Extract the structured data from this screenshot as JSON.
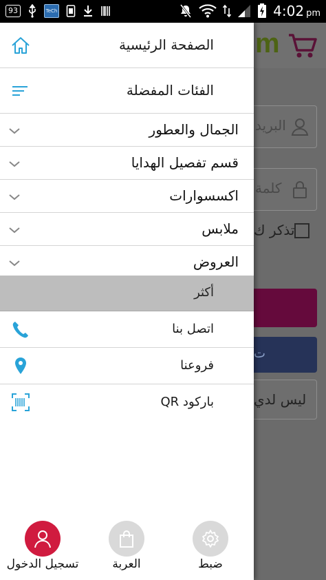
{
  "status_bar": {
    "battery_badge": "93",
    "app_badge": "TeCh",
    "time": "4:02",
    "ampm": "pm"
  },
  "background_app": {
    "logo_text": "m",
    "username_placeholder": "البريد",
    "password_placeholder": "كلمة",
    "remember_me": "تذكر ك",
    "facebook_text": "ت",
    "register_text": "ليس لدي"
  },
  "drawer": {
    "home_label": "الصفحة الرئيسية",
    "favorites_label": "الفئات المفضلة",
    "categories": [
      {
        "label": "الجمال والعطور"
      },
      {
        "label": "قسم تفصيل الهدايا"
      },
      {
        "label": "اكسسوارات"
      },
      {
        "label": "ملابس"
      },
      {
        "label": "العروض"
      }
    ],
    "more_label": "أكثر",
    "contact_label": "اتصل بنا",
    "branches_label": "فروعنا",
    "qr_label": "باركود QR"
  },
  "bottom_bar": {
    "settings_label": "ضبط",
    "cart_label": "العربة",
    "login_label": "تسجيل الدخول"
  },
  "colors": {
    "accent_blue": "#29a3d8",
    "login_red": "#d01b3f",
    "inactive_gray": "#d9d9d9",
    "magenta": "#650a3c",
    "facebook": "#263358"
  }
}
